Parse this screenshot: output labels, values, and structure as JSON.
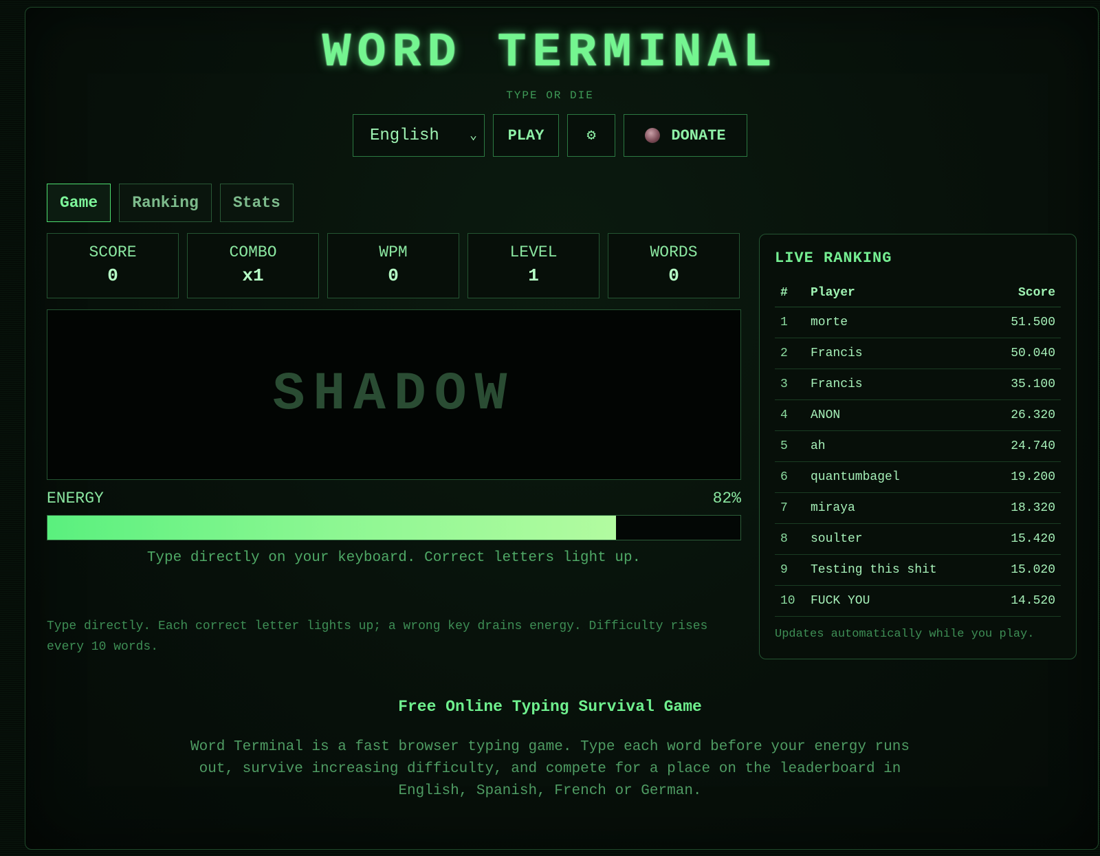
{
  "header": {
    "title": "WORD TERMINAL",
    "subtitle": "TYPE OR DIE"
  },
  "controls": {
    "language_selected": "English",
    "language_chevron": "⌄",
    "play_label": "PLAY",
    "settings_glyph": "⚙",
    "donate_label": "DONATE"
  },
  "tabs": [
    {
      "label": "Game",
      "active": true
    },
    {
      "label": "Ranking",
      "active": false
    },
    {
      "label": "Stats",
      "active": false
    }
  ],
  "stats": [
    {
      "label": "SCORE",
      "value": "0"
    },
    {
      "label": "COMBO",
      "value": "x1"
    },
    {
      "label": "WPM",
      "value": "0"
    },
    {
      "label": "LEVEL",
      "value": "1"
    },
    {
      "label": "WORDS",
      "value": "0"
    }
  ],
  "game": {
    "current_word": "SHADOW",
    "energy_label": "ENERGY",
    "energy_percent_text": "82%",
    "energy_level": 0.82,
    "hint": "Type directly on your keyboard. Correct letters light up.",
    "help": "Type directly. Each correct letter lights up; a wrong key drains energy. Difficulty rises every 10 words."
  },
  "ranking": {
    "title": "LIVE RANKING",
    "columns": {
      "rank": "#",
      "player": "Player",
      "score": "Score"
    },
    "rows": [
      {
        "rank": "1",
        "player": "morte",
        "score": "51.500"
      },
      {
        "rank": "2",
        "player": "Francis",
        "score": "50.040"
      },
      {
        "rank": "3",
        "player": "Francis",
        "score": "35.100"
      },
      {
        "rank": "4",
        "player": "ANON",
        "score": "26.320"
      },
      {
        "rank": "5",
        "player": "ah",
        "score": "24.740"
      },
      {
        "rank": "6",
        "player": "quantumbagel",
        "score": "19.200"
      },
      {
        "rank": "7",
        "player": "miraya",
        "score": "18.320"
      },
      {
        "rank": "8",
        "player": "soulter",
        "score": "15.420"
      },
      {
        "rank": "9",
        "player": "Testing this shit",
        "score": "15.020"
      },
      {
        "rank": "10",
        "player": "FUCK YOU",
        "score": "14.520"
      }
    ],
    "footer": "Updates automatically while you play."
  },
  "seo": {
    "title": "Free Online Typing Survival Game",
    "text": "Word Terminal is a fast browser typing game. Type each word before your energy runs out, survive increasing difficulty, and compete for a place on the leaderboard in English, Spanish, French or German."
  },
  "icons": {
    "settings": "gear-icon",
    "donate": "coffee-cup-icon",
    "language": "chevron-down-icon"
  },
  "colors": {
    "accent": "#74f590",
    "background": "#050c07",
    "energy_fill_start": "#5af07e",
    "energy_fill_end": "#b2fba0"
  }
}
